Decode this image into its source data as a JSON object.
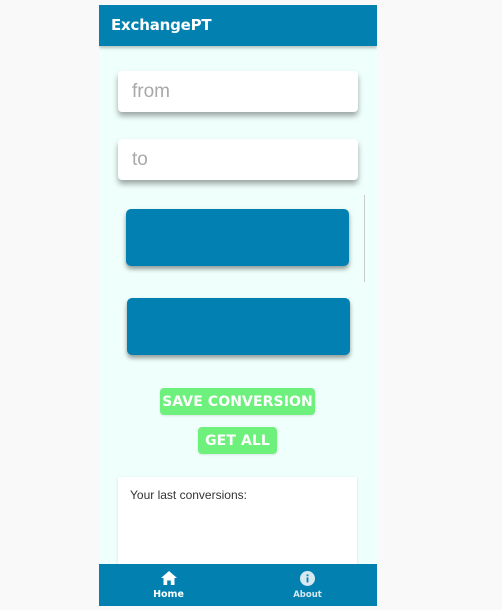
{
  "app": {
    "title": "ExchangePT"
  },
  "form": {
    "from_placeholder": "from",
    "to_placeholder": "to",
    "from_value": "",
    "to_value": ""
  },
  "actions": {
    "save_label": "SAVE CONVERSION",
    "get_all_label": "GET ALL"
  },
  "history": {
    "title": "Your last conversions:"
  },
  "bottom_nav": {
    "items": [
      {
        "label": "Home",
        "icon": "home-icon"
      },
      {
        "label": "About",
        "icon": "info-icon"
      }
    ],
    "active": "Home"
  },
  "colors": {
    "primary": "#0281b0",
    "background": "#effffb",
    "accent_green": "#6ef07c"
  }
}
